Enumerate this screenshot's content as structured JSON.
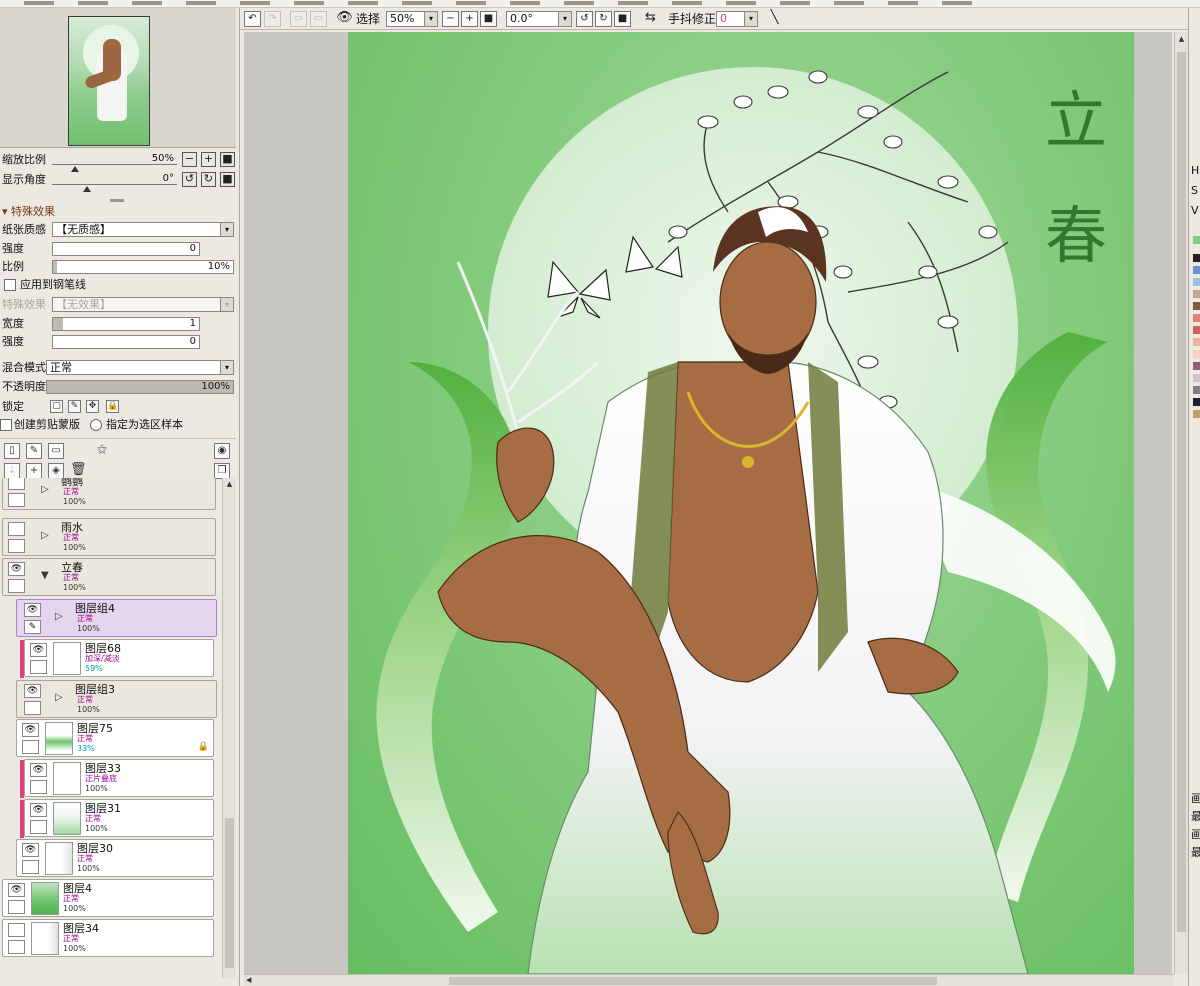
{
  "navigator": {
    "zoom_label": "缩放比例",
    "zoom_value": "50%",
    "angle_label": "显示角度",
    "angle_value": "0°"
  },
  "effects": {
    "section_title": "特殊效果",
    "paper_label": "纸张质感",
    "paper_value": "【无质感】",
    "strength_label": "强度",
    "strength_value": "0",
    "ratio_label": "比例",
    "ratio_value": "10%",
    "apply_pen_label": "应用到钢笔线",
    "effect_label": "特殊效果",
    "effect_value": "【无效果】",
    "width_label": "宽度",
    "width_value": "1",
    "strength2_label": "强度",
    "strength2_value": "0"
  },
  "layer_props": {
    "blend_label": "混合模式",
    "blend_value": "正常",
    "opacity_label": "不透明度",
    "opacity_value": "100%",
    "lock_label": "锁定",
    "clip_label": "创建剪贴蒙版",
    "sample_label": "指定为选区样本"
  },
  "layers": [
    {
      "name": "鹦鹦",
      "mode": "正常",
      "opacity": "100%"
    },
    {
      "name": "雨水",
      "mode": "正常",
      "opacity": "100%"
    },
    {
      "name": "立春",
      "mode": "正常",
      "opacity": "100%"
    },
    {
      "name": "图层组4",
      "mode": "正常",
      "opacity": "100%"
    },
    {
      "name": "图层68",
      "mode": "加深/减淡",
      "opacity": "59%"
    },
    {
      "name": "图层组3",
      "mode": "正常",
      "opacity": "100%"
    },
    {
      "name": "图层75",
      "mode": "正常",
      "opacity": "33%"
    },
    {
      "name": "图层33",
      "mode": "正片叠底",
      "opacity": "100%"
    },
    {
      "name": "图层31",
      "mode": "正常",
      "opacity": "100%"
    },
    {
      "name": "图层30",
      "mode": "正常",
      "opacity": "100%"
    },
    {
      "name": "图层4",
      "mode": "正常",
      "opacity": "100%"
    },
    {
      "name": "图层34",
      "mode": "正常",
      "opacity": "100%"
    }
  ],
  "toolbar": {
    "select_label": "选择",
    "zoom_value": "50%",
    "angle_value": "0.0°",
    "stabilizer_label": "手抖修正",
    "stabilizer_value": "0"
  },
  "artwork": {
    "title_char1": "立",
    "title_char2": "春"
  },
  "right_panel": {
    "labels": [
      "H",
      "S",
      "V"
    ],
    "cut_labels": [
      "画",
      "最",
      "画",
      "最"
    ]
  },
  "colors": {
    "accent_pink": "#e0407a",
    "selected_layer": "#e5d5ee",
    "canvas_green": "#86cc80",
    "section_head": "#7a3a12"
  }
}
